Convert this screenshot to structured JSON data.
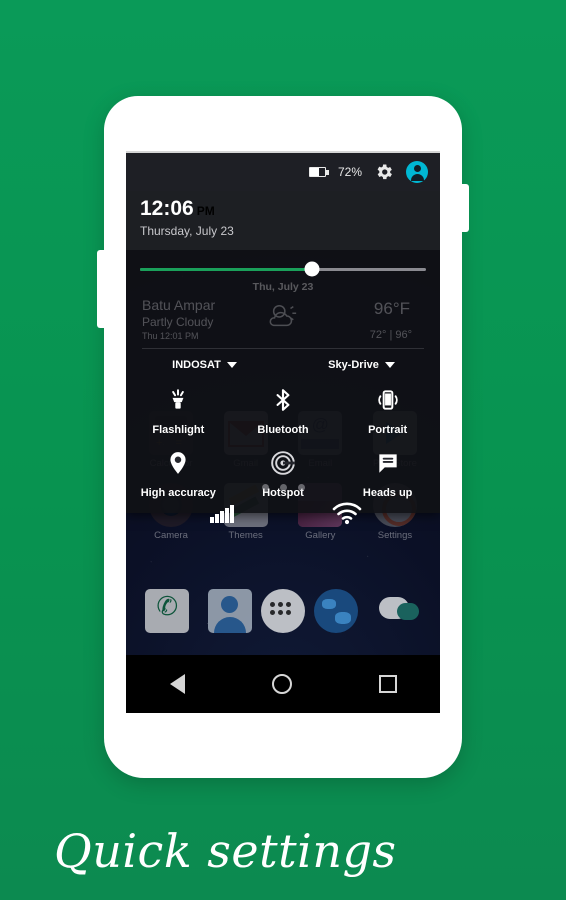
{
  "caption": "Quick settings",
  "theme": {
    "background_green": "#089350",
    "accent_green": "#1aa05a",
    "avatar_cyan": "#00b8d4",
    "panel_bg": "#101116"
  },
  "phone": {
    "volume_rocker": "volume-rocker",
    "power_button": "power-button"
  },
  "status_bar": {
    "battery_percent": "72%",
    "gear_icon": "gear-icon",
    "avatar_icon": "user-avatar-icon"
  },
  "clock": {
    "time": "12:06",
    "ampm": "PM",
    "date": "Thursday, July 23"
  },
  "brightness": {
    "value_percent": 60,
    "label": "brightness-slider"
  },
  "weather_widget": {
    "date": "Thu, July 23",
    "city": "Batu Ampar",
    "condition": "Partly Cloudy",
    "updated": "Thu 12:01 PM",
    "temperature": "96°F",
    "range": "72° | 96°"
  },
  "network": {
    "carrier": "INDOSAT",
    "wifi": "Sky-Drive"
  },
  "tiles": [
    {
      "label": "Flashlight",
      "icon": "flashlight-icon"
    },
    {
      "label": "Bluetooth",
      "icon": "bluetooth-icon"
    },
    {
      "label": "Portrait",
      "icon": "screen-rotation-icon"
    },
    {
      "label": "High accuracy",
      "icon": "location-pin-icon"
    },
    {
      "label": "Hotspot",
      "icon": "hotspot-icon"
    },
    {
      "label": "Heads up",
      "icon": "speech-bubble-icon"
    }
  ],
  "page_dots": 3,
  "app_drawer": {
    "row1": [
      {
        "label": "Calculator",
        "icon": "calculator-icon"
      },
      {
        "label": "Gmail",
        "icon": "gmail-icon"
      },
      {
        "label": "Email",
        "icon": "email-icon"
      },
      {
        "label": "Play Store",
        "icon": "play-store-icon"
      }
    ],
    "row2": [
      {
        "label": "Camera",
        "icon": "camera-icon"
      },
      {
        "label": "Themes",
        "icon": "themes-icon"
      },
      {
        "label": "Gallery",
        "icon": "gallery-icon"
      },
      {
        "label": "Settings",
        "icon": "settings-icon"
      }
    ]
  },
  "dock": [
    {
      "icon": "phone-icon"
    },
    {
      "icon": "contacts-icon"
    },
    {
      "icon": "app-drawer-icon"
    },
    {
      "icon": "browser-icon"
    },
    {
      "icon": "messaging-icon"
    }
  ],
  "nav_bar": {
    "back": "back-nav-icon",
    "home": "home-nav-icon",
    "recents": "recents-nav-icon"
  }
}
